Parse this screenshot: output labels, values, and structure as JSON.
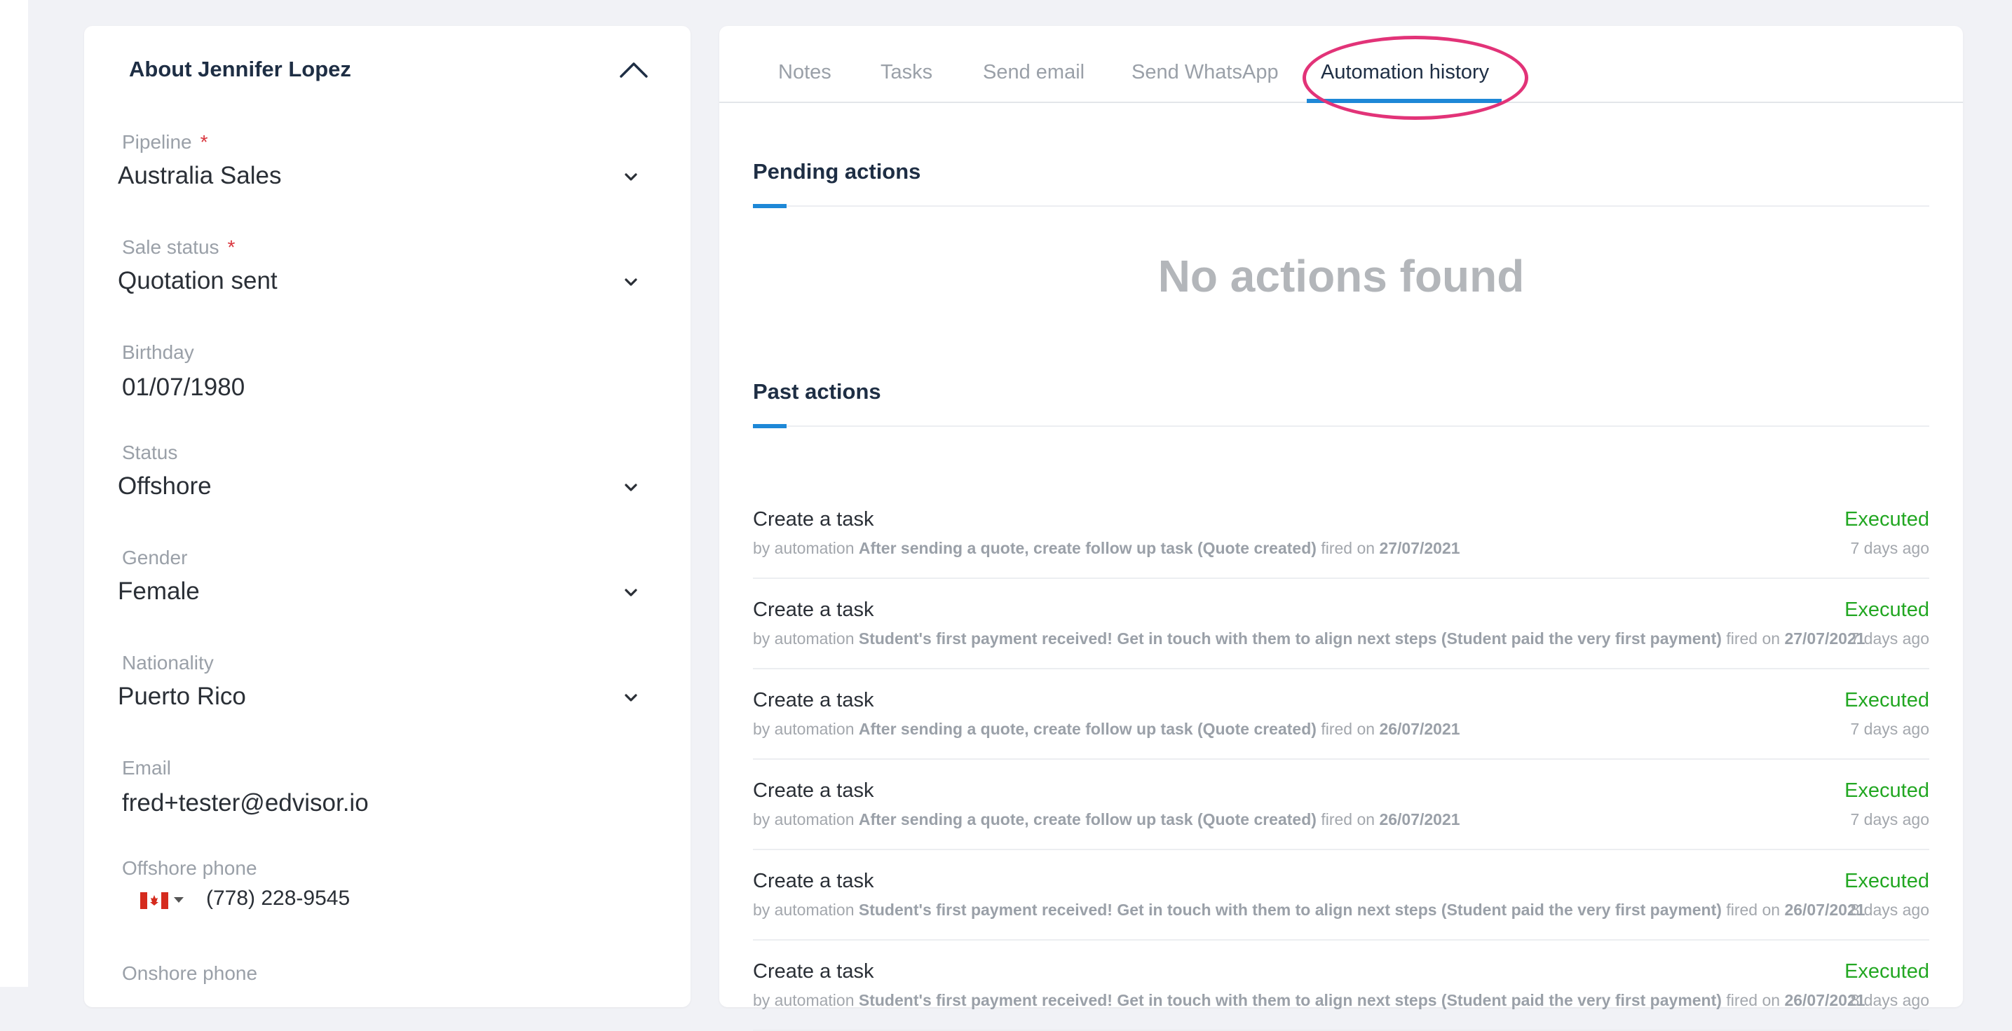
{
  "about": {
    "title": "About Jennifer Lopez",
    "fields": {
      "pipeline": {
        "label": "Pipeline",
        "value": "Australia Sales",
        "required": "*"
      },
      "sale_status": {
        "label": "Sale status",
        "value": "Quotation sent",
        "required": "*"
      },
      "birthday": {
        "label": "Birthday",
        "value": "01/07/1980"
      },
      "status": {
        "label": "Status",
        "value": "Offshore"
      },
      "gender": {
        "label": "Gender",
        "value": "Female"
      },
      "nationality": {
        "label": "Nationality",
        "value": "Puerto Rico"
      },
      "email": {
        "label": "Email",
        "value": "fred+tester@edvisor.io"
      },
      "offshore_phone": {
        "label": "Offshore phone",
        "value": "(778) 228-9545",
        "flag": "canada-flag-icon"
      },
      "onshore_phone": {
        "label": "Onshore phone"
      }
    }
  },
  "tabs": [
    {
      "label": "Notes"
    },
    {
      "label": "Tasks"
    },
    {
      "label": "Send email"
    },
    {
      "label": "Send WhatsApp"
    },
    {
      "label": "Automation history",
      "active": true
    }
  ],
  "pending": {
    "title": "Pending actions",
    "empty_message": "No actions found"
  },
  "past": {
    "title": "Past actions",
    "actions": [
      {
        "title": "Create a task",
        "by": "by automation",
        "automation": "After sending a quote, create follow up task (Quote created)",
        "fired": "fired on",
        "date": "27/07/2021",
        "status": "Executed",
        "age": "7 days ago"
      },
      {
        "title": "Create a task",
        "by": "by automation",
        "automation": "Student's first payment received! Get in touch with them to align next steps (Student paid the very first payment)",
        "fired": "fired on",
        "date": "27/07/2021",
        "status": "Executed",
        "age": "7 days ago"
      },
      {
        "title": "Create a task",
        "by": "by automation",
        "automation": "After sending a quote, create follow up task (Quote created)",
        "fired": "fired on",
        "date": "26/07/2021",
        "status": "Executed",
        "age": "7 days ago"
      },
      {
        "title": "Create a task",
        "by": "by automation",
        "automation": "After sending a quote, create follow up task (Quote created)",
        "fired": "fired on",
        "date": "26/07/2021",
        "status": "Executed",
        "age": "7 days ago"
      },
      {
        "title": "Create a task",
        "by": "by automation",
        "automation": "Student's first payment received! Get in touch with them to align next steps (Student paid the very first payment)",
        "fired": "fired on",
        "date": "26/07/2021",
        "status": "Executed",
        "age": "8 days ago"
      },
      {
        "title": "Create a task",
        "by": "by automation",
        "automation": "Student's first payment received! Get in touch with them to align next steps (Student paid the very first payment)",
        "fired": "fired on",
        "date": "26/07/2021",
        "status": "Executed",
        "age": "8 days ago"
      }
    ]
  },
  "colors": {
    "accent": "#1e88d7",
    "executed": "#22a722",
    "highlight": "#e23378",
    "required": "#d9363e"
  }
}
